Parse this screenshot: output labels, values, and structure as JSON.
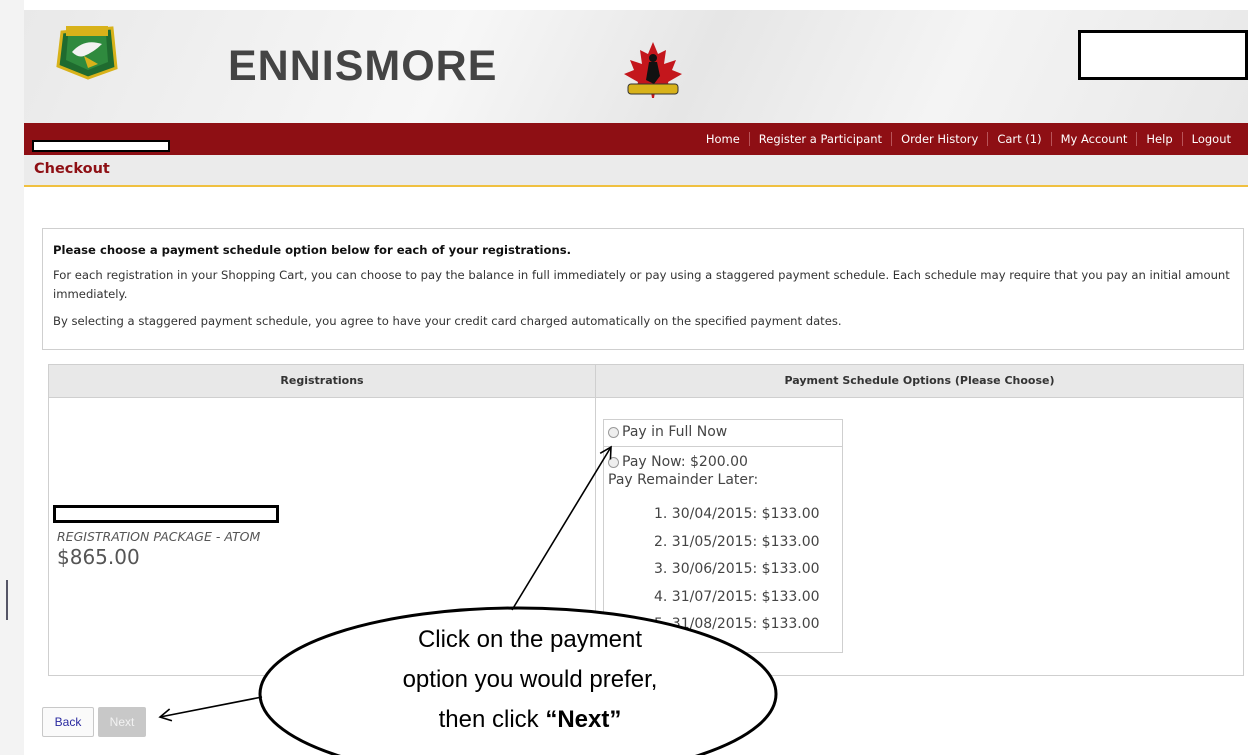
{
  "header": {
    "org_name": "ENNISMORE"
  },
  "nav": {
    "links": [
      "Home",
      "Register a Participant",
      "Order History",
      "Cart (1)",
      "My Account",
      "Help",
      "Logout"
    ]
  },
  "page": {
    "title": "Checkout"
  },
  "info": {
    "heading": "Please choose a payment schedule option below for each of your registrations.",
    "para1": "For each registration in your Shopping Cart, you can choose to pay the balance in full immediately or pay using a staggered payment schedule. Each schedule may require that you pay an initial amount immediately.",
    "para2": "By selecting a staggered payment schedule, you agree to have your credit card charged automatically on the specified payment dates."
  },
  "table": {
    "col1_header": "Registrations",
    "col2_header": "Payment Schedule Options (Please Choose)",
    "registration": {
      "package": "REGISTRATION PACKAGE - ATOM",
      "price": "$865.00"
    },
    "options": {
      "full": "Pay in Full Now",
      "staggered_now": "Pay Now: $200.00",
      "staggered_later": "Pay Remainder Later:",
      "schedule": [
        "1. 30/04/2015: $133.00",
        "2. 31/05/2015: $133.00",
        "3. 30/06/2015: $133.00",
        "4. 31/07/2015: $133.00",
        "5. 31/08/2015: $133.00"
      ]
    }
  },
  "buttons": {
    "back": "Back",
    "next": "Next"
  },
  "callout": {
    "line1": "Click on the payment",
    "line2": "option you would prefer,",
    "line3_prefix": "then click ",
    "line3_bold": "“Next”"
  },
  "colors": {
    "navbar": "#8e0f14",
    "title": "#8e0f14",
    "accent_line": "#f0c040"
  }
}
